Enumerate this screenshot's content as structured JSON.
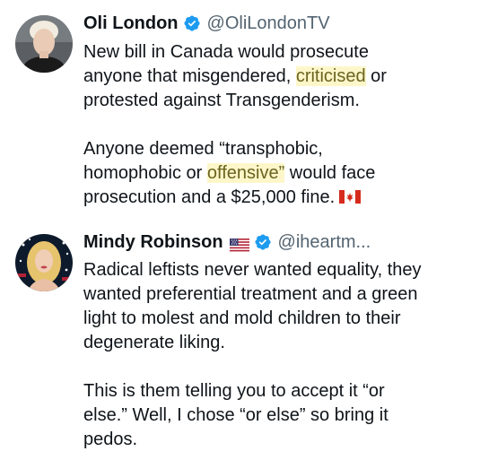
{
  "tweets": [
    {
      "display_name": "Oli London",
      "handle": "@OliLondonTV",
      "verified": true,
      "avatar_icon": "profile-photo",
      "lines": [
        {
          "text": "New bill in Canada would prosecute"
        },
        {
          "pre": "anyone that misgendered, ",
          "highlight": "criticised",
          "post": " or"
        },
        {
          "text": "protested against Transgenderism."
        },
        {
          "text": "Anyone deemed “transphobic,"
        },
        {
          "pre": "homophobic or ",
          "highlight": "offensive”",
          "post": " would face"
        },
        {
          "text": "prosecution and a $25,000 fine."
        }
      ],
      "trailing_icon": "canada-flag-icon"
    },
    {
      "display_name": "Mindy Robinson",
      "handle": "@iheartm...",
      "verified": true,
      "name_emoji": "us-flag-icon",
      "avatar_icon": "profile-photo",
      "lines": [
        "Radical leftists never wanted equality, they",
        "wanted preferential treatment and a green",
        "light to molest and mold children to their",
        "degenerate liking.",
        "This is them telling you to accept it “or",
        "else.” Well, I chose “or else” so bring it",
        "pedos."
      ]
    }
  ],
  "colors": {
    "text": "#0f1419",
    "handle": "#536471",
    "verified": "#1d9bf0",
    "highlight_bg": "#fdf6c9"
  }
}
